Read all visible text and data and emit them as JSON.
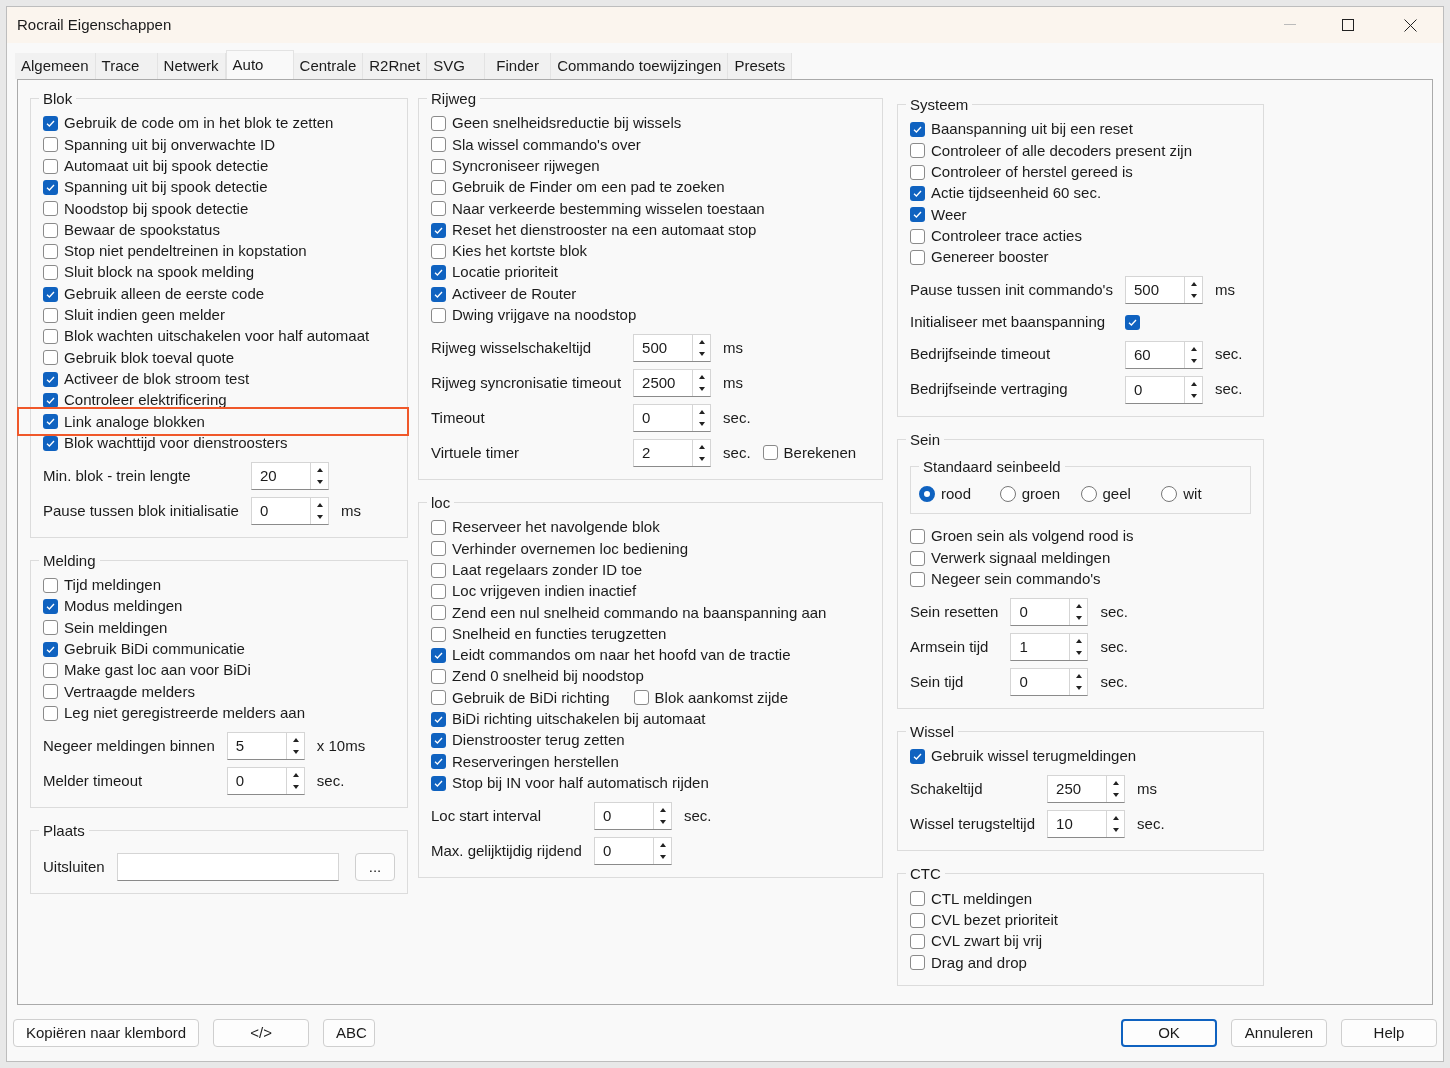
{
  "window": {
    "title": "Rocrail Eigenschappen"
  },
  "tabs": [
    {
      "label": "Algemeen",
      "selected": false
    },
    {
      "label": "Trace",
      "selected": false
    },
    {
      "label": "Netwerk",
      "selected": false
    },
    {
      "label": "Auto",
      "selected": true
    },
    {
      "label": "Centrale",
      "selected": false
    },
    {
      "label": "R2Rnet",
      "selected": false
    },
    {
      "label": "SVG",
      "selected": false
    },
    {
      "label": "Finder",
      "selected": false
    },
    {
      "label": "Commando toewijzingen",
      "selected": false
    },
    {
      "label": "Presets",
      "selected": false
    }
  ],
  "columns": [
    [
      {
        "title": "Blok",
        "items": [
          {
            "kind": "checkbox",
            "label": "Gebruik de code om in het blok te zetten",
            "checked": true
          },
          {
            "kind": "checkbox",
            "label": "Spanning uit bij onverwachte ID",
            "checked": false
          },
          {
            "kind": "checkbox",
            "label": "Automaat uit bij spook detectie",
            "checked": false
          },
          {
            "kind": "checkbox",
            "label": "Spanning uit bij spook detectie",
            "checked": true
          },
          {
            "kind": "checkbox",
            "label": "Noodstop bij spook detectie",
            "checked": false
          },
          {
            "kind": "checkbox",
            "label": "Bewaar de spookstatus",
            "checked": false
          },
          {
            "kind": "checkbox",
            "label": "Stop niet pendeltreinen in kopstation",
            "checked": false
          },
          {
            "kind": "checkbox",
            "label": "Sluit block na spook melding",
            "checked": false
          },
          {
            "kind": "checkbox",
            "label": "Gebruik alleen de eerste code",
            "checked": true
          },
          {
            "kind": "checkbox",
            "label": "Sluit indien geen melder",
            "checked": false
          },
          {
            "kind": "checkbox",
            "label": "Blok wachten uitschakelen voor half automaat",
            "checked": false
          },
          {
            "kind": "checkbox",
            "label": "Gebruik blok toeval quote",
            "checked": false
          },
          {
            "kind": "checkbox",
            "label": "Activeer de blok stroom test",
            "checked": true
          },
          {
            "kind": "checkbox",
            "label": "Controleer elektrificering",
            "checked": true
          },
          {
            "kind": "checkbox",
            "label": "Link analoge blokken",
            "checked": true,
            "highlighted": true
          },
          {
            "kind": "checkbox",
            "label": "Blok wachttijd voor dienstroosters",
            "checked": true
          },
          {
            "kind": "spin",
            "label": "Min. blok - trein lengte",
            "value": "20"
          },
          {
            "kind": "spin",
            "label": "Pause tussen blok initialisatie",
            "value": "0",
            "unit": "ms"
          }
        ]
      },
      {
        "title": "Melding",
        "items": [
          {
            "kind": "checkbox",
            "label": "Tijd meldingen",
            "checked": false
          },
          {
            "kind": "checkbox",
            "label": "Modus meldingen",
            "checked": true
          },
          {
            "kind": "checkbox",
            "label": "Sein meldingen",
            "checked": false
          },
          {
            "kind": "checkbox",
            "label": "Gebruik BiDi communicatie",
            "checked": true
          },
          {
            "kind": "checkbox",
            "label": "Make gast loc aan voor BiDi",
            "checked": false
          },
          {
            "kind": "checkbox",
            "label": "Vertraagde melders",
            "checked": false
          },
          {
            "kind": "checkbox",
            "label": "Leg niet geregistreerde melders aan",
            "checked": false
          },
          {
            "kind": "spin",
            "label": "Negeer meldingen binnen",
            "value": "5",
            "unit": "x 10ms"
          },
          {
            "kind": "spin",
            "label": "Melder timeout",
            "value": "0",
            "unit": "sec."
          }
        ]
      },
      {
        "title": "Plaats",
        "items": [
          {
            "kind": "field",
            "label": "Uitsluiten",
            "button": "..."
          }
        ]
      }
    ],
    [
      {
        "title": "Rijweg",
        "items": [
          {
            "kind": "checkbox",
            "label": "Geen snelheidsreductie bij wissels",
            "checked": false
          },
          {
            "kind": "checkbox",
            "label": "Sla wissel commando's over",
            "checked": false
          },
          {
            "kind": "checkbox",
            "label": "Syncroniseer rijwegen",
            "checked": false
          },
          {
            "kind": "checkbox",
            "label": "Gebruik de Finder om een pad te zoeken",
            "checked": false
          },
          {
            "kind": "checkbox",
            "label": "Naar verkeerde bestemming wisselen toestaan",
            "checked": false
          },
          {
            "kind": "checkbox",
            "label": "Reset het dienstrooster na een automaat stop",
            "checked": true
          },
          {
            "kind": "checkbox",
            "label": "Kies het kortste blok",
            "checked": false
          },
          {
            "kind": "checkbox",
            "label": "Locatie prioriteit",
            "checked": true
          },
          {
            "kind": "checkbox",
            "label": "Activeer de Router",
            "checked": true
          },
          {
            "kind": "checkbox",
            "label": "Dwing vrijgave na noodstop",
            "checked": false
          },
          {
            "kind": "spin",
            "label": "Rijweg wisselschakeltijd",
            "value": "500",
            "unit": "ms"
          },
          {
            "kind": "spin",
            "label": "Rijweg syncronisatie timeout",
            "value": "2500",
            "unit": "ms"
          },
          {
            "kind": "spin",
            "label": "Timeout",
            "value": "0",
            "unit": "sec."
          },
          {
            "kind": "spin",
            "label": "Virtuele timer",
            "value": "2",
            "unit": "sec.",
            "extra": {
              "label": "Berekenen",
              "checked": false
            }
          }
        ]
      },
      {
        "title": "loc",
        "items": [
          {
            "kind": "checkbox",
            "label": "Reserveer het navolgende blok",
            "checked": false
          },
          {
            "kind": "checkbox",
            "label": "Verhinder overnemen loc bediening",
            "checked": false
          },
          {
            "kind": "checkbox",
            "label": "Laat regelaars zonder ID toe",
            "checked": false
          },
          {
            "kind": "checkbox",
            "label": "Loc vrijgeven indien inactief",
            "checked": false
          },
          {
            "kind": "checkbox",
            "label": "Zend een nul snelheid commando na baanspanning aan",
            "checked": false
          },
          {
            "kind": "checkbox",
            "label": "Snelheid en functies terugzetten",
            "checked": false
          },
          {
            "kind": "checkbox",
            "label": "Leidt commandos om naar het hoofd van de tractie",
            "checked": true
          },
          {
            "kind": "checkbox",
            "label": "Zend 0 snelheid bij noodstop",
            "checked": false
          },
          {
            "kind": "checkbox",
            "label": "Gebruik de BiDi richting",
            "checked": false,
            "extra": {
              "label": "Blok aankomst zijde",
              "checked": false
            }
          },
          {
            "kind": "checkbox",
            "label": "BiDi richting uitschakelen bij automaat",
            "checked": true
          },
          {
            "kind": "checkbox",
            "label": "Dienstrooster terug zetten",
            "checked": true
          },
          {
            "kind": "checkbox",
            "label": "Reserveringen herstellen",
            "checked": true
          },
          {
            "kind": "checkbox",
            "label": "Stop bij IN voor half automatisch rijden",
            "checked": true
          },
          {
            "kind": "spin",
            "label": "Loc start interval",
            "value": "0",
            "unit": "sec."
          },
          {
            "kind": "spin",
            "label": "Max. gelijktijdig rijdend",
            "value": "0"
          }
        ]
      }
    ],
    [
      {
        "title": "Systeem",
        "items": [
          {
            "kind": "checkbox",
            "label": "Baanspanning uit bij een reset",
            "checked": true
          },
          {
            "kind": "checkbox",
            "label": "Controleer of alle decoders present zijn",
            "checked": false
          },
          {
            "kind": "checkbox",
            "label": "Controleer of herstel gereed is",
            "checked": false
          },
          {
            "kind": "checkbox",
            "label": "Actie tijdseenheid 60 sec.",
            "checked": true
          },
          {
            "kind": "checkbox",
            "label": "Weer",
            "checked": true
          },
          {
            "kind": "checkbox",
            "label": "Controleer trace acties",
            "checked": false
          },
          {
            "kind": "checkbox",
            "label": "Genereer booster",
            "checked": false
          },
          {
            "kind": "spin",
            "label": "Pause tussen init commando's",
            "value": "500",
            "unit": "ms"
          },
          {
            "kind": "labeled-check",
            "label": "Initialiseer met baanspanning",
            "checked": true
          },
          {
            "kind": "spin",
            "label": "Bedrijfseinde timeout",
            "value": "60",
            "unit": "sec."
          },
          {
            "kind": "spin",
            "label": "Bedrijfseinde vertraging",
            "value": "0",
            "unit": "sec."
          }
        ]
      },
      {
        "title": "Sein",
        "items": [
          {
            "kind": "radio-group",
            "title": "Standaard seinbeeld",
            "options": [
              {
                "label": "rood",
                "selected": true
              },
              {
                "label": "groen",
                "selected": false
              },
              {
                "label": "geel",
                "selected": false
              },
              {
                "label": "wit",
                "selected": false
              }
            ]
          },
          {
            "kind": "checkbox",
            "label": "Groen sein als volgend rood is",
            "checked": false
          },
          {
            "kind": "checkbox",
            "label": "Verwerk signaal meldingen",
            "checked": false
          },
          {
            "kind": "checkbox",
            "label": "Negeer  sein commando's",
            "checked": false
          },
          {
            "kind": "spin",
            "label": "Sein resetten",
            "value": "0",
            "unit": "sec."
          },
          {
            "kind": "spin",
            "label": "Armsein tijd",
            "value": "1",
            "unit": "sec."
          },
          {
            "kind": "spin",
            "label": "Sein tijd",
            "value": "0",
            "unit": "sec."
          }
        ]
      },
      {
        "title": "Wissel",
        "items": [
          {
            "kind": "checkbox",
            "label": "Gebruik wissel terugmeldingen",
            "checked": true
          },
          {
            "kind": "spin",
            "label": "Schakeltijd",
            "value": "250",
            "unit": "ms"
          },
          {
            "kind": "spin",
            "label": "Wissel terugsteltijd",
            "value": "10",
            "unit": "sec."
          }
        ]
      },
      {
        "title": "CTC",
        "items": [
          {
            "kind": "checkbox",
            "label": "CTL meldingen",
            "checked": false
          },
          {
            "kind": "checkbox",
            "label": "CVL bezet prioriteit",
            "checked": false
          },
          {
            "kind": "checkbox",
            "label": "CVL zwart bij vrij",
            "checked": false
          },
          {
            "kind": "checkbox",
            "label": "Drag and drop",
            "checked": false
          }
        ]
      }
    ]
  ],
  "buttons_left": [
    "Kopiëren naar klembord",
    "</>",
    "ABC"
  ],
  "buttons_right": [
    {
      "label": "OK",
      "default": true
    },
    {
      "label": "Annuleren",
      "default": false
    },
    {
      "label": "Help",
      "default": false
    }
  ]
}
